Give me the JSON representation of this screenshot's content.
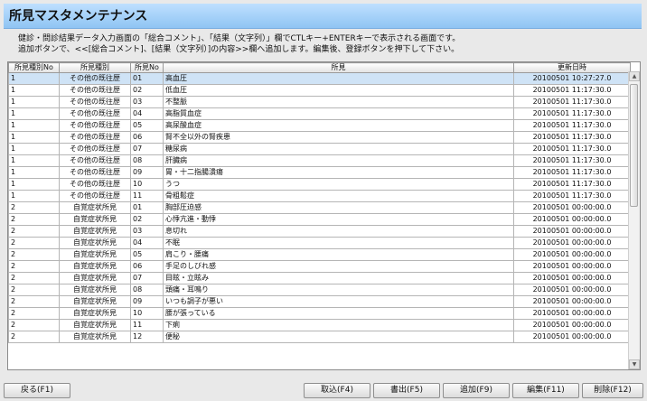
{
  "title": "所見マスタメンテナンス",
  "description": [
    "健診・問診結果データ入力画面の「総合コメント」、「結果（文字列）」欄でCTLキー+ENTERキーで表示される画面です。",
    "追加ボタンで、<<[総合コメント]、[結果（文字列）]の内容>>欄へ追加します。編集後、登録ボタンを押下して下さい。"
  ],
  "grid": {
    "columns": [
      "所見種別No",
      "所見種別",
      "所見No",
      "所見",
      "更新日時"
    ],
    "rows": [
      [
        "1",
        "その他の既往歴",
        "01",
        "高血圧",
        "20100501 10:27:27.0"
      ],
      [
        "1",
        "その他の既往歴",
        "02",
        "低血圧",
        "20100501 11:17:30.0"
      ],
      [
        "1",
        "その他の既往歴",
        "03",
        "不整脈",
        "20100501 11:17:30.0"
      ],
      [
        "1",
        "その他の既往歴",
        "04",
        "高脂質血症",
        "20100501 11:17:30.0"
      ],
      [
        "1",
        "その他の既往歴",
        "05",
        "高尿酸血症",
        "20100501 11:17:30.0"
      ],
      [
        "1",
        "その他の既往歴",
        "06",
        "腎不全以外の腎疾患",
        "20100501 11:17:30.0"
      ],
      [
        "1",
        "その他の既往歴",
        "07",
        "糖尿病",
        "20100501 11:17:30.0"
      ],
      [
        "1",
        "その他の既往歴",
        "08",
        "肝臓病",
        "20100501 11:17:30.0"
      ],
      [
        "1",
        "その他の既往歴",
        "09",
        "胃・十二指腸潰瘍",
        "20100501 11:17:30.0"
      ],
      [
        "1",
        "その他の既往歴",
        "10",
        "うつ",
        "20100501 11:17:30.0"
      ],
      [
        "1",
        "その他の既往歴",
        "11",
        "骨粗鬆症",
        "20100501 11:17:30.0"
      ],
      [
        "2",
        "自覚症状所見",
        "01",
        "胸部圧迫感",
        "20100501 00:00:00.0"
      ],
      [
        "2",
        "自覚症状所見",
        "02",
        "心悸亢進・動悸",
        "20100501 00:00:00.0"
      ],
      [
        "2",
        "自覚症状所見",
        "03",
        "息切れ",
        "20100501 00:00:00.0"
      ],
      [
        "2",
        "自覚症状所見",
        "04",
        "不眠",
        "20100501 00:00:00.0"
      ],
      [
        "2",
        "自覚症状所見",
        "05",
        "肩こり・腰痛",
        "20100501 00:00:00.0"
      ],
      [
        "2",
        "自覚症状所見",
        "06",
        "手足のしびれ感",
        "20100501 00:00:00.0"
      ],
      [
        "2",
        "自覚症状所見",
        "07",
        "目眩・立眩み",
        "20100501 00:00:00.0"
      ],
      [
        "2",
        "自覚症状所見",
        "08",
        "頭痛・耳鳴り",
        "20100501 00:00:00.0"
      ],
      [
        "2",
        "自覚症状所見",
        "09",
        "いつも調子が悪い",
        "20100501 00:00:00.0"
      ],
      [
        "2",
        "自覚症状所見",
        "10",
        "腰が張っている",
        "20100501 00:00:00.0"
      ],
      [
        "2",
        "自覚症状所見",
        "11",
        "下痢",
        "20100501 00:00:00.0"
      ],
      [
        "2",
        "自覚症状所見",
        "12",
        "便秘",
        "20100501 00:00:00.0"
      ]
    ]
  },
  "buttons": {
    "back": "戻る(F1)",
    "import": "取込(F4)",
    "export": "書出(F5)",
    "add": "追加(F9)",
    "edit": "編集(F11)",
    "delete": "削除(F12)"
  },
  "colors": {
    "title_bg": "#9ccaf3",
    "selected_row": "#cfe3f6"
  }
}
